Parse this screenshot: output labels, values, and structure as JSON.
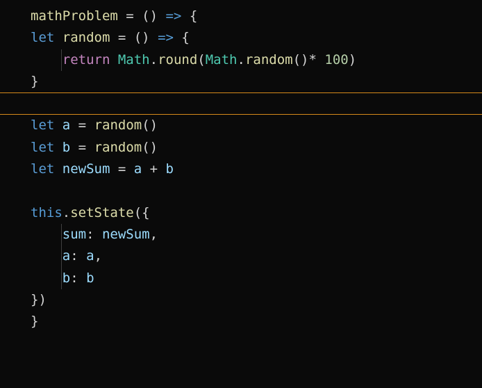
{
  "code": {
    "l1": {
      "a": "mathProblem",
      "b": " = () ",
      "c": "=>",
      "d": " {"
    },
    "l2": {
      "a": "let",
      "b": " ",
      "c": "random",
      "d": " = () ",
      "e": "=>",
      "f": " {"
    },
    "l3": {
      "a": "    ",
      "b": "return",
      "c": " ",
      "d": "Math",
      "e": ".",
      "f": "round",
      "g": "(",
      "h": "Math",
      "i": ".",
      "j": "random",
      "k": "()",
      "l": "* ",
      "m": "100",
      "n": ")"
    },
    "l4": {
      "a": "}"
    },
    "l5": {
      "a": "let",
      "b": " ",
      "c": "a",
      "d": " = ",
      "e": "random",
      "f": "()"
    },
    "l6": {
      "a": "let",
      "b": " ",
      "c": "b",
      "d": " = ",
      "e": "random",
      "f": "()"
    },
    "l7": {
      "a": "let",
      "b": " ",
      "c": "newSum",
      "d": " = ",
      "e": "a",
      "f": " + ",
      "g": "b"
    },
    "l8": {
      "a": "this",
      "b": ".",
      "c": "setState",
      "d": "({"
    },
    "l9": {
      "a": "    ",
      "b": "sum",
      "c": ": ",
      "d": "newSum",
      "e": ","
    },
    "l10": {
      "a": "    ",
      "b": "a",
      "c": ": ",
      "d": "a",
      "e": ","
    },
    "l11": {
      "a": "    ",
      "b": "b",
      "c": ": ",
      "d": "b"
    },
    "l12": {
      "a": "})"
    },
    "l13": {
      "a": "}"
    }
  }
}
